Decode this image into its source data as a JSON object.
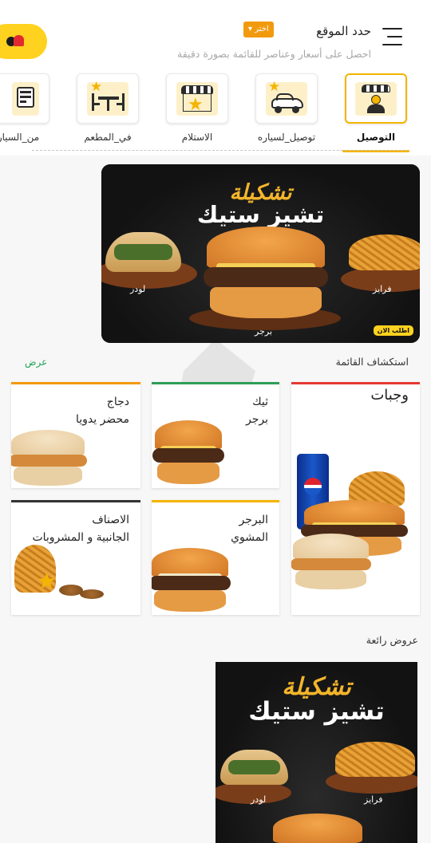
{
  "header": {
    "location_title": "حدد الموقع",
    "choose_badge": "اختر ▾",
    "location_subtitle": "احصل على أسعار وعناصر للقائمة بصورة دقيقة"
  },
  "categories": [
    {
      "label": "التوصيل",
      "icon": "delivery-shop-icon",
      "active": true
    },
    {
      "label": "توصيل_لسياره",
      "icon": "car-delivery-icon",
      "active": false
    },
    {
      "label": "الاستلام",
      "icon": "pickup-shop-icon",
      "active": false
    },
    {
      "label": "في_المطعم",
      "icon": "dine-in-icon",
      "active": false
    },
    {
      "label": "من_السيار",
      "icon": "drive-thru-icon",
      "active": false
    }
  ],
  "banner": {
    "title_line1": "تشكيلة",
    "title_line2": "تشيز ستيك",
    "label_wrap": "لودر",
    "label_burger": "برجر",
    "label_fries": "فرايز",
    "order_now": "اطلب الان"
  },
  "explore": {
    "title": "استكشاف القائمة",
    "view_link": "عرض"
  },
  "menu_cards": [
    {
      "name": "وجبات",
      "accent": "#e53935"
    },
    {
      "name_line1": "ثيك",
      "name_line2": "برجر",
      "accent": "#2e9e57"
    },
    {
      "name_line1": "دجاج",
      "name_line2": "محضر يدويا",
      "accent": "#f29a0e"
    },
    {
      "name_line1": "البرجر",
      "name_line2": "المشوي",
      "accent": "#f5b400"
    },
    {
      "name_line1": "الاصناف",
      "name_line2": "الجانبية و المشروبات",
      "accent": "#333333"
    }
  ],
  "offers": {
    "title": "عروض رائعة",
    "banner_line1": "تشكيلة",
    "banner_line2": "تشيز ستيك",
    "label_wrap": "لودر",
    "label_fries": "فرايز"
  },
  "colors": {
    "brand_yellow": "#ffd21f",
    "active_border": "#f5b400",
    "link_green": "#22a354",
    "banner_gold": "#f3b52a"
  }
}
